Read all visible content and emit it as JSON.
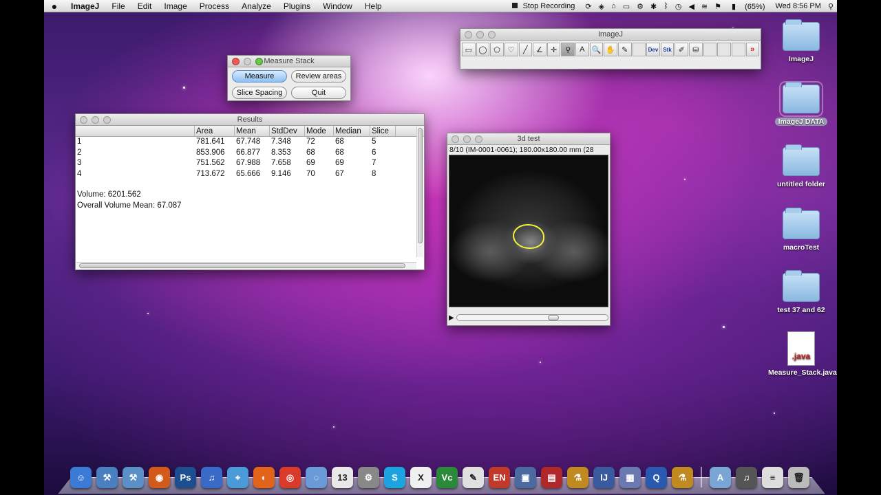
{
  "menubar": {
    "apple": "",
    "items": [
      "ImageJ",
      "File",
      "Edit",
      "Image",
      "Process",
      "Analyze",
      "Plugins",
      "Window",
      "Help"
    ],
    "recording": "Stop Recording",
    "battery": "(65%)",
    "clock": "Wed 8:56 PM"
  },
  "measure_stack": {
    "title": "Measure Stack",
    "buttons": [
      "Measure",
      "Review areas",
      "Slice Spacing",
      "Quit"
    ]
  },
  "imagej_toolbar": {
    "title": "ImageJ",
    "tools": [
      {
        "icon": "rectangle-tool-icon",
        "glyph": "▭"
      },
      {
        "icon": "oval-tool-icon",
        "glyph": "◯"
      },
      {
        "icon": "polygon-tool-icon",
        "glyph": "⬠"
      },
      {
        "icon": "freehand-tool-icon",
        "glyph": "♡"
      },
      {
        "icon": "line-tool-icon",
        "glyph": "╱"
      },
      {
        "icon": "angle-tool-icon",
        "glyph": "∠"
      },
      {
        "icon": "point-tool-icon",
        "glyph": "✛"
      },
      {
        "icon": "wand-tool-icon",
        "glyph": "⚲",
        "active": true
      },
      {
        "icon": "text-tool-icon",
        "glyph": "A"
      },
      {
        "icon": "magnifier-tool-icon",
        "glyph": "🔍"
      },
      {
        "icon": "hand-tool-icon",
        "glyph": "✋"
      },
      {
        "icon": "dropper-tool-icon",
        "glyph": "✎"
      },
      {
        "icon": "blank-tool-icon",
        "glyph": ""
      },
      {
        "icon": "developer-menu-icon",
        "glyph": "Dev"
      },
      {
        "icon": "stack-menu-icon",
        "glyph": "Stk"
      },
      {
        "icon": "brush-tool-icon",
        "glyph": "✐"
      },
      {
        "icon": "flood-fill-tool-icon",
        "glyph": "⛁"
      },
      {
        "icon": "blank-tool-icon",
        "glyph": ""
      },
      {
        "icon": "blank-tool-icon",
        "glyph": ""
      },
      {
        "icon": "blank-tool-icon",
        "glyph": ""
      },
      {
        "icon": "more-tools-icon",
        "glyph": "»"
      }
    ]
  },
  "results": {
    "title": "Results",
    "columns": [
      "",
      "Area",
      "Mean",
      "StdDev",
      "Mode",
      "Median",
      "Slice"
    ],
    "rows": [
      [
        "1",
        "781.641",
        "67.748",
        "7.348",
        "72",
        "68",
        "5"
      ],
      [
        "2",
        "853.906",
        "66.877",
        "8.353",
        "68",
        "68",
        "6"
      ],
      [
        "3",
        "751.562",
        "67.988",
        "7.658",
        "69",
        "69",
        "7"
      ],
      [
        "4",
        "713.672",
        "65.666",
        "9.146",
        "70",
        "67",
        "8"
      ]
    ],
    "volume": "Volume: 6201.562",
    "volume_mean": "Overall Volume Mean: 67.087"
  },
  "image_window": {
    "title": "3d test",
    "info": "8/10 (IM-0001-0061); 180.00x180.00 mm (28"
  },
  "desktop": {
    "items": [
      {
        "label": "ImageJ",
        "kind": "folder"
      },
      {
        "label": "ImageJ DATA",
        "kind": "folder",
        "selected": true
      },
      {
        "label": "untitled folder",
        "kind": "folder"
      },
      {
        "label": "macroTest",
        "kind": "folder"
      },
      {
        "label": "test 37 and 62",
        "kind": "folder"
      },
      {
        "label": "Measure_Stack.java",
        "kind": "file",
        "badge": ".java"
      }
    ]
  },
  "dock": {
    "apps": [
      {
        "name": "finder-icon",
        "glyph": "☺",
        "color": "#3b7bd6"
      },
      {
        "name": "xcode-icon",
        "glyph": "⚒",
        "color": "#4a7fc0"
      },
      {
        "name": "instruments-icon",
        "glyph": "⚒",
        "color": "#5a8fc8"
      },
      {
        "name": "game-icon",
        "glyph": "◉",
        "color": "#d25a1a"
      },
      {
        "name": "photoshop-icon",
        "glyph": "Ps",
        "color": "#1d4e8f"
      },
      {
        "name": "itunes-icon",
        "glyph": "♫",
        "color": "#3a6ac8"
      },
      {
        "name": "safari-icon",
        "glyph": "⌖",
        "color": "#4a9ad8"
      },
      {
        "name": "firefox-icon",
        "glyph": "◐",
        "color": "#e2631a"
      },
      {
        "name": "chrome-icon",
        "glyph": "◎",
        "color": "#d93a2a"
      },
      {
        "name": "ichat-icon",
        "glyph": "◌",
        "color": "#6a9ad8"
      },
      {
        "name": "ical-icon",
        "glyph": "13",
        "color": "#e8e8e8"
      },
      {
        "name": "system-prefs-icon",
        "glyph": "⚙",
        "color": "#888"
      },
      {
        "name": "skype-icon",
        "glyph": "S",
        "color": "#1da3e0"
      },
      {
        "name": "x11-icon",
        "glyph": "X",
        "color": "#f0f0f0"
      },
      {
        "name": "vnc-icon",
        "glyph": "Vc",
        "color": "#2a8a3a"
      },
      {
        "name": "textedit-icon",
        "glyph": "✎",
        "color": "#e0e0e0"
      },
      {
        "name": "evernote-icon",
        "glyph": "EN",
        "color": "#c0392b"
      },
      {
        "name": "virtualbox-icon",
        "glyph": "▣",
        "color": "#4a6aa0"
      },
      {
        "name": "parallels-icon",
        "glyph": "▤",
        "color": "#b0282a"
      },
      {
        "name": "tool-icon",
        "glyph": "⚗",
        "color": "#c08a20"
      },
      {
        "name": "imagej-dock-icon",
        "glyph": "IJ",
        "color": "#3a5aa0"
      },
      {
        "name": "preview-icon",
        "glyph": "▦",
        "color": "#6a7ab0"
      },
      {
        "name": "quicktime-icon",
        "glyph": "Q",
        "color": "#2a5ab0"
      },
      {
        "name": "utility-icon",
        "glyph": "⚗",
        "color": "#c08a20"
      }
    ],
    "stacks": [
      {
        "name": "applications-stack-icon",
        "glyph": "A",
        "color": "#7aa6d6"
      },
      {
        "name": "music-stack-icon",
        "glyph": "♫",
        "color": "#555"
      },
      {
        "name": "documents-stack-icon",
        "glyph": "≡",
        "color": "#ddd"
      },
      {
        "name": "trash-icon",
        "glyph": "🗑",
        "color": "#bbb"
      }
    ]
  }
}
